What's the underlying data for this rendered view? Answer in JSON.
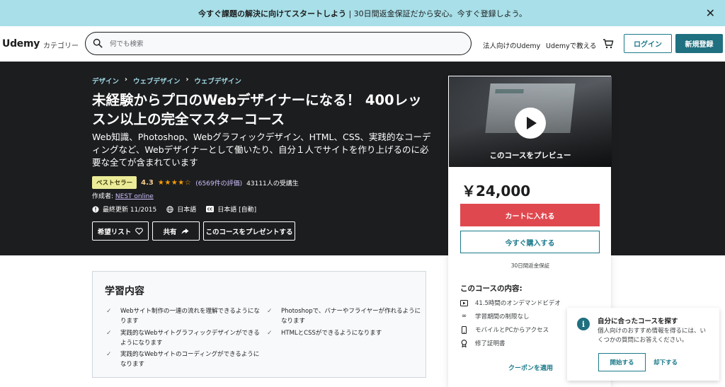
{
  "banner": {
    "bold": "今すぐ課題の解決に向けてスタートしよう",
    "rest": " | 30日間返金保証だから安心。今すぐ登録しよう。",
    "close": "✕"
  },
  "header": {
    "logo": "Udemy",
    "categories": "カテゴリー",
    "search_placeholder": "何でも検索",
    "business": "法人向けのUdemy",
    "teach": "Udemyで教える",
    "login": "ログイン",
    "signup": "新規登録"
  },
  "course": {
    "breadcrumbs": [
      "デザイン",
      "ウェブデザイン",
      "ウェブデザイン"
    ],
    "title": "未経験からプロのWebデザイナーになる！ 400レッスン以上の完全マスターコース",
    "subtitle": "Web知識、Photoshop、Webグラフィックデザイン、HTML、CSS、実践的なコーディングなど、Webデザイナーとして働いたり、自分１人でサイトを作り上げるのに必要な全てが含まれています",
    "badge": "ベストセラー",
    "rating": "4.3",
    "stars": "★★★★☆",
    "reviews": "(6569件の評価)",
    "students": "43111人の受講生",
    "author_label": "作成者: ",
    "author": "NEST online",
    "updated": "最終更新 11/2015",
    "language": "日本語",
    "captions": "日本語 [自動]",
    "wishlist": "希望リスト",
    "share": "共有",
    "gift": "このコースをプレゼントする"
  },
  "sidebar": {
    "preview_label": "このコースをプレビュー",
    "price": "￥24,000",
    "add_cart": "カートに入れる",
    "buy_now": "今すぐ購入する",
    "guarantee": "30日間返金保証",
    "includes_title": "このコースの内容:",
    "includes": [
      {
        "icon": "video-icon",
        "label": "41.5時間のオンデマンドビデオ"
      },
      {
        "icon": "infinity-icon",
        "label": "学習期間の制限なし"
      },
      {
        "icon": "mobile-icon",
        "label": "モバイルとPCからアクセス"
      },
      {
        "icon": "certificate-icon",
        "label": "修了証明書"
      }
    ],
    "coupon": "クーポンを適用"
  },
  "learn": {
    "title": "学習内容",
    "items": [
      "Webサイト制作の一連の流れを理解できるようになります",
      "Photoshopで、バナーやフライヤーが作れるようになります",
      "実践的なWebサイトグラフィックデザインができるようになります",
      "HTMLとCSSができるようになります",
      "実践的なWebサイトのコーディングができるようになります"
    ]
  },
  "popup": {
    "title": "自分に合ったコースを探す",
    "body": "個人向けのおすすめ情報を得るには、いくつかの質問にお答えください。",
    "start": "開始する",
    "skip": "却下する"
  }
}
